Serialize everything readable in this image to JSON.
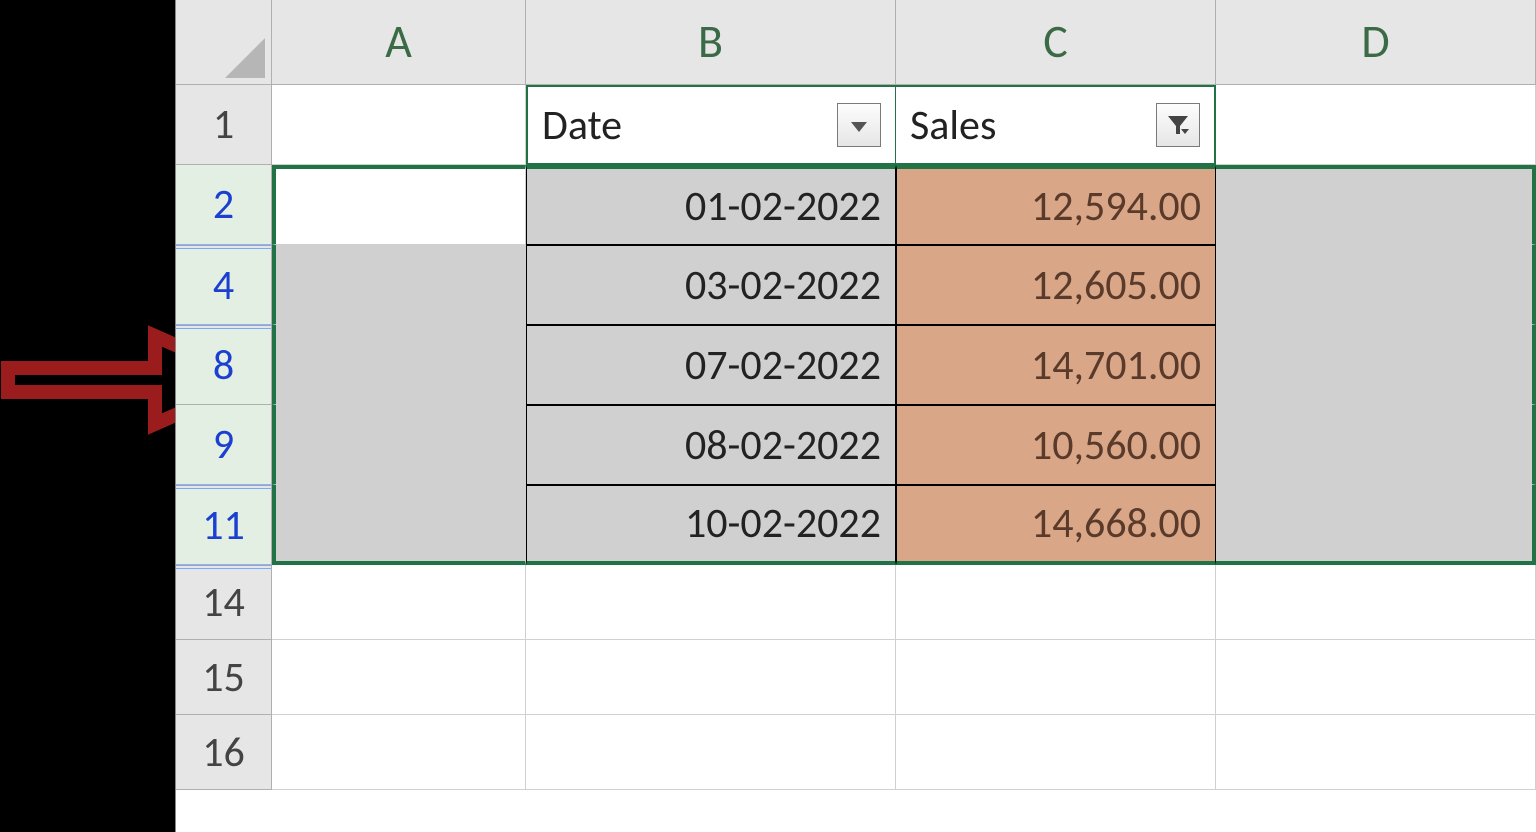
{
  "columns": {
    "A": "A",
    "B": "B",
    "C": "C",
    "D": "D"
  },
  "visible_row_numbers": [
    "1",
    "2",
    "4",
    "8",
    "9",
    "11",
    "14",
    "15",
    "16"
  ],
  "headers": {
    "B": "Date",
    "C": "Sales"
  },
  "filter_state": {
    "B": "dropdown",
    "C": "filtered"
  },
  "data_rows": [
    {
      "row": "2",
      "date": "01-02-2022",
      "sales": "12,594.00"
    },
    {
      "row": "4",
      "date": "03-02-2022",
      "sales": "12,605.00"
    },
    {
      "row": "8",
      "date": "07-02-2022",
      "sales": "14,701.00"
    },
    {
      "row": "9",
      "date": "08-02-2022",
      "sales": "10,560.00"
    },
    {
      "row": "11",
      "date": "10-02-2022",
      "sales": "14,668.00"
    }
  ],
  "colors": {
    "excel_green": "#217346",
    "sales_fill": "#d9a787",
    "selection_fill": "#d0d0d0",
    "filtered_row_num": "#1a3fd1",
    "arrow_stroke": "#9b1c1c"
  },
  "annotation": {
    "arrow_points_to_row": "8"
  }
}
